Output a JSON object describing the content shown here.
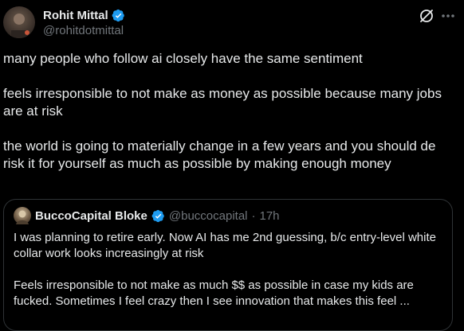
{
  "author": {
    "display_name": "Rohit Mittal",
    "handle": "@rohitdotmittal",
    "verified": true
  },
  "icons": {
    "verified": "verified-badge-icon",
    "grok": "grok-icon",
    "more": "more-icon"
  },
  "colors": {
    "background": "#000000",
    "text_primary": "#e7e9ea",
    "text_secondary": "#71767b",
    "verified_blue": "#1d9bf0",
    "border": "#2f3336"
  },
  "tweet": {
    "paragraphs": [
      "many people who follow ai closely have the same sentiment",
      "feels irresponsible to not make as money as possible because many jobs are at risk",
      "the world is going to materially change in a few years and you should de risk it for yourself as much as possible by making enough money"
    ]
  },
  "quote": {
    "display_name": "BuccoCapital Bloke",
    "handle": "@buccocapital",
    "separator": "·",
    "time": "17h",
    "verified": true,
    "paragraphs": [
      "I was planning to retire early. Now AI has me 2nd guessing, b/c entry-level white collar work looks increasingly at risk",
      "Feels irresponsible to not make as much $$ as possible in case my kids are fucked. Sometimes I feel crazy then I see innovation that makes this feel ..."
    ]
  }
}
